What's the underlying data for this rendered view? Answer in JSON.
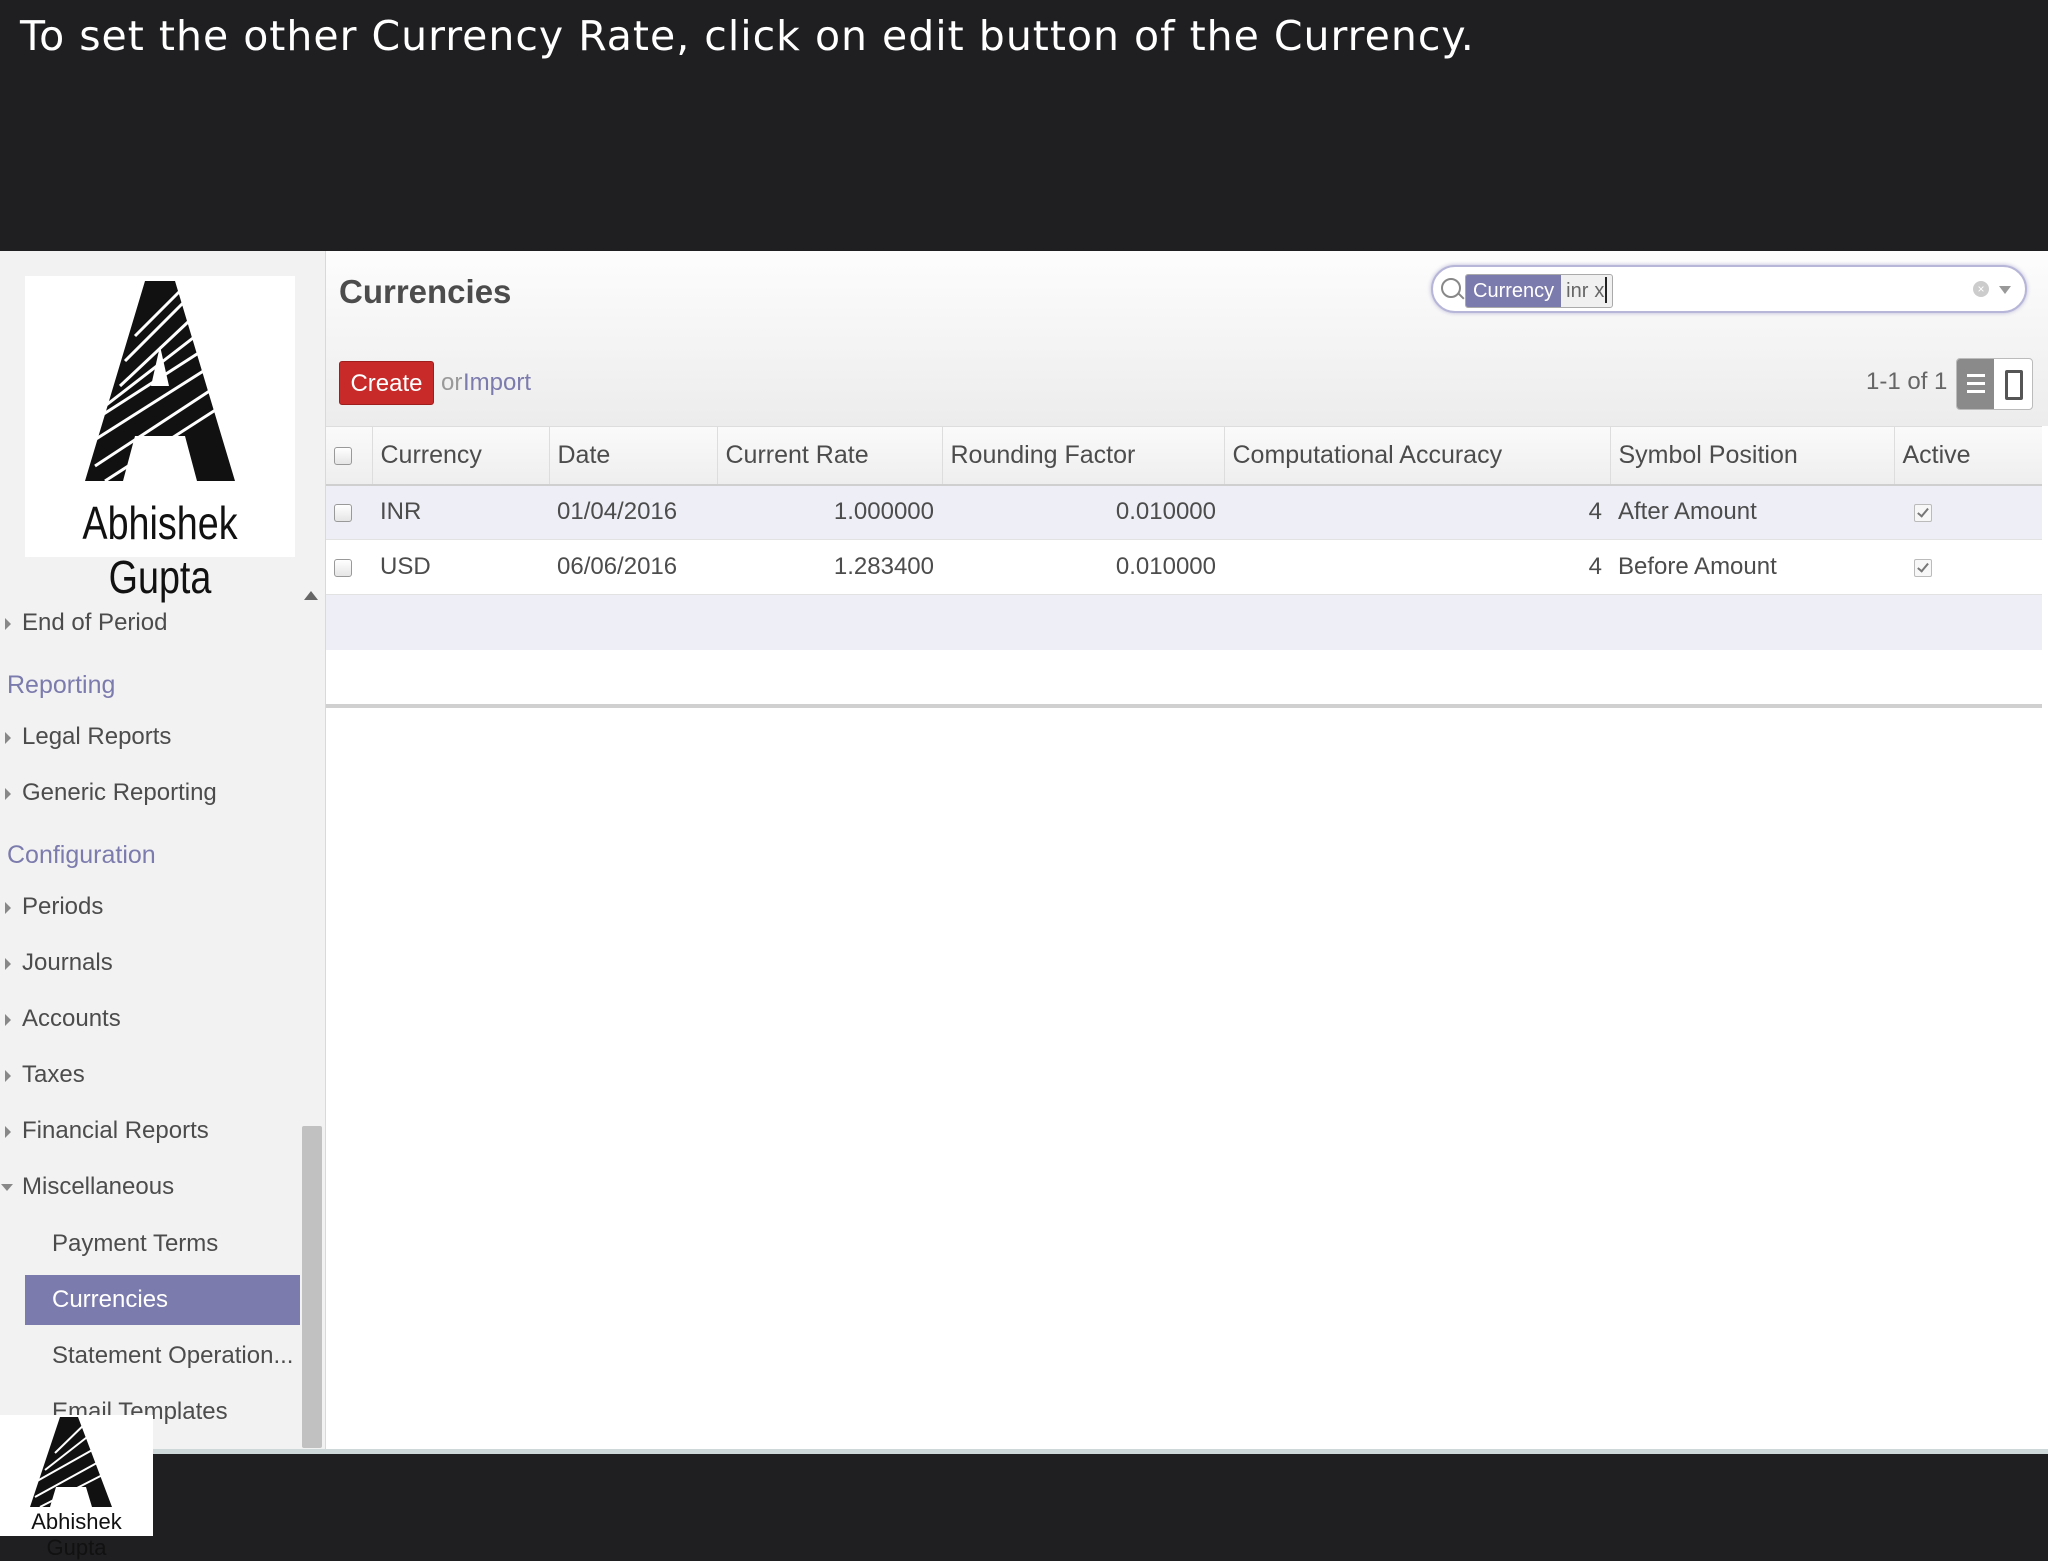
{
  "caption": "To set the other Currency Rate, click on edit button of the Currency.",
  "logo": {
    "text": "Abhishek Gupta"
  },
  "sidebar": {
    "items": [
      {
        "label": "End of Period",
        "type": "item"
      },
      {
        "label": "Reporting",
        "type": "section"
      },
      {
        "label": "Legal Reports",
        "type": "item"
      },
      {
        "label": "Generic Reporting",
        "type": "item"
      },
      {
        "label": "Configuration",
        "type": "section"
      },
      {
        "label": "Periods",
        "type": "item"
      },
      {
        "label": "Journals",
        "type": "item"
      },
      {
        "label": "Accounts",
        "type": "item"
      },
      {
        "label": "Taxes",
        "type": "item"
      },
      {
        "label": "Financial Reports",
        "type": "item"
      },
      {
        "label": "Miscellaneous",
        "type": "item-expanded"
      }
    ],
    "submenu": [
      {
        "label": "Payment Terms",
        "active": false
      },
      {
        "label": "Currencies",
        "active": true
      },
      {
        "label": "Statement Operation...",
        "active": false
      },
      {
        "label": "Email Templates",
        "active": false
      }
    ]
  },
  "main": {
    "title": "Currencies",
    "search": {
      "facet_category": "Currency",
      "facet_value": "inr",
      "facet_remove": "x",
      "value": ""
    },
    "create_label": "Create",
    "or_label": "or",
    "import_label": "Import",
    "pager": "1-1 of 1",
    "table": {
      "columns": [
        "Currency",
        "Date",
        "Current Rate",
        "Rounding Factor",
        "Computational Accuracy",
        "Symbol Position",
        "Active"
      ],
      "rows": [
        {
          "currency": "INR",
          "date": "01/04/2016",
          "rate": "1.000000",
          "rounding": "0.010000",
          "accuracy": "4",
          "position": "After Amount",
          "active": true
        },
        {
          "currency": "USD",
          "date": "06/06/2016",
          "rate": "1.283400",
          "rounding": "0.010000",
          "accuracy": "4",
          "position": "Before Amount",
          "active": true
        }
      ]
    }
  },
  "colors": {
    "accent": "#7c7bad",
    "create": "#c82a29",
    "caption_bg": "#1f1e21"
  }
}
